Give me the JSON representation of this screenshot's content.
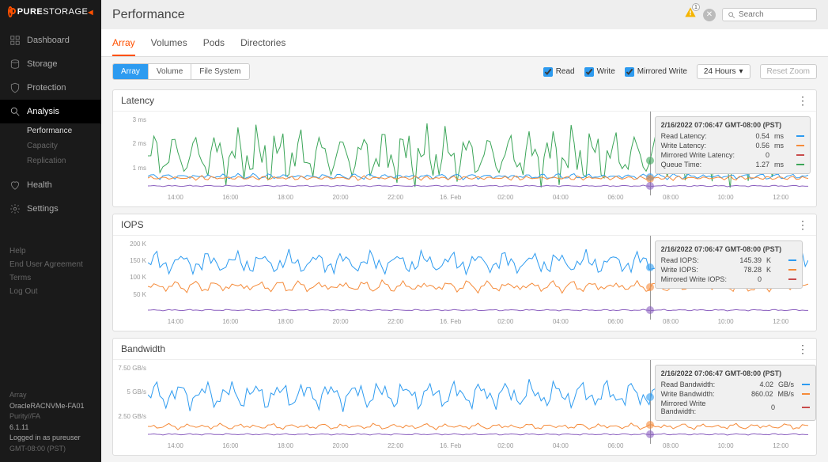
{
  "brand": {
    "pure": "PURE",
    "storage": "STORAGE"
  },
  "page_title": "Performance",
  "search": {
    "placeholder": "Search"
  },
  "alerts": {
    "count": "1"
  },
  "nav": {
    "items": [
      {
        "label": "Dashboard",
        "icon": "dashboard"
      },
      {
        "label": "Storage",
        "icon": "storage"
      },
      {
        "label": "Protection",
        "icon": "shield"
      },
      {
        "label": "Analysis",
        "icon": "magnify",
        "active": true,
        "sub": [
          {
            "label": "Performance",
            "sel": true
          },
          {
            "label": "Capacity"
          },
          {
            "label": "Replication"
          }
        ]
      },
      {
        "label": "Health",
        "icon": "heart"
      },
      {
        "label": "Settings",
        "icon": "gear"
      }
    ]
  },
  "footer_links": [
    "Help",
    "End User Agreement",
    "Terms",
    "Log Out"
  ],
  "status": {
    "l1": "Array",
    "l2": "OracleRACNVMe-FA01",
    "l3": "Purity//FA",
    "l4": "6.1.11",
    "l5": "Logged in as pureuser",
    "l6": "GMT-08:00 (PST)"
  },
  "tabs": [
    "Array",
    "Volumes",
    "Pods",
    "Directories"
  ],
  "tabs_active": 0,
  "scope_buttons": [
    "Array",
    "Volume",
    "File System"
  ],
  "scope_active": 0,
  "series_checks": [
    {
      "label": "Read",
      "checked": true
    },
    {
      "label": "Write",
      "checked": true
    },
    {
      "label": "Mirrored Write",
      "checked": true
    }
  ],
  "time_range": "24 Hours",
  "reset_zoom": "Reset Zoom",
  "x_ticks": [
    "14:00",
    "16:00",
    "18:00",
    "20:00",
    "22:00",
    "16. Feb",
    "02:00",
    "04:00",
    "06:00",
    "08:00",
    "10:00",
    "12:00"
  ],
  "cursor_pos_pct": 76,
  "cursor_ts": "2/16/2022 07:06:47 GMT-08:00 (PST)",
  "panels": {
    "latency": {
      "title": "Latency",
      "y": [
        "3 ms",
        "2 ms",
        "1 ms"
      ],
      "tooltip": [
        {
          "lbl": "Read Latency:",
          "val": "0.54",
          "unit": "ms",
          "color": "#2d9bf0"
        },
        {
          "lbl": "Write Latency:",
          "val": "0.56",
          "unit": "ms",
          "color": "#f58b3a"
        },
        {
          "lbl": "Mirrored Write Latency:",
          "val": "0",
          "unit": "",
          "color": "#c84b4b"
        },
        {
          "lbl": "Queue Time:",
          "val": "1.27",
          "unit": "ms",
          "color": "#3ba558"
        }
      ]
    },
    "iops": {
      "title": "IOPS",
      "y": [
        "200 K",
        "150 K",
        "100 K",
        "50 K"
      ],
      "tooltip": [
        {
          "lbl": "Read IOPS:",
          "val": "145.39",
          "unit": "K",
          "color": "#2d9bf0"
        },
        {
          "lbl": "Write IOPS:",
          "val": "78.28",
          "unit": "K",
          "color": "#f58b3a"
        },
        {
          "lbl": "Mirrored Write IOPS:",
          "val": "0",
          "unit": "",
          "color": "#c84b4b"
        }
      ]
    },
    "bandwidth": {
      "title": "Bandwidth",
      "y": [
        "7.50 GB/s",
        "5 GB/s",
        "2.50 GB/s"
      ],
      "tooltip": [
        {
          "lbl": "Read Bandwidth:",
          "val": "4.02",
          "unit": "GB/s",
          "color": "#2d9bf0"
        },
        {
          "lbl": "Write Bandwidth:",
          "val": "860.02",
          "unit": "MB/s",
          "color": "#f58b3a"
        },
        {
          "lbl": "Mirrored Write Bandwidth:",
          "val": "0",
          "unit": "",
          "color": "#c84b4b"
        }
      ]
    }
  },
  "chart_data": {
    "x_hours": [
      14,
      15,
      16,
      17,
      18,
      19,
      20,
      21,
      22,
      23,
      0,
      1,
      2,
      3,
      4,
      5,
      6,
      7,
      8,
      9,
      10,
      11,
      12,
      13
    ],
    "charts": [
      {
        "type": "line",
        "title": "Latency",
        "ylabel": "ms",
        "ylim": [
          0,
          3
        ],
        "series": [
          {
            "name": "Queue Time",
            "color": "#3ba558",
            "values": [
              1.6,
              2.1,
              1.4,
              1.9,
              2.3,
              1.3,
              1.7,
              2.4,
              1.5,
              2.0,
              1.2,
              2.2,
              1.6,
              1.9,
              2.5,
              1.4,
              2.1,
              1.3,
              1.8,
              2.2,
              1.5,
              2.0,
              1.7,
              2.3
            ]
          },
          {
            "name": "Read Latency",
            "color": "#2d9bf0",
            "values": [
              0.5,
              0.55,
              0.52,
              0.54,
              0.56,
              0.53,
              0.55,
              0.57,
              0.54,
              0.55,
              0.52,
              0.56,
              0.55,
              0.54,
              0.57,
              0.53,
              0.55,
              0.54,
              0.56,
              0.55,
              0.53,
              0.55,
              0.54,
              0.56
            ]
          },
          {
            "name": "Write Latency",
            "color": "#f58b3a",
            "values": [
              0.54,
              0.56,
              0.55,
              0.57,
              0.56,
              0.55,
              0.56,
              0.58,
              0.56,
              0.57,
              0.55,
              0.57,
              0.56,
              0.56,
              0.58,
              0.55,
              0.56,
              0.56,
              0.57,
              0.56,
              0.55,
              0.56,
              0.56,
              0.57
            ]
          },
          {
            "name": "Mirrored Write Latency",
            "color": "#8b5fbf",
            "values": [
              0,
              0,
              0,
              0,
              0,
              0,
              0,
              0,
              0,
              0,
              0,
              0,
              0,
              0,
              0,
              0,
              0,
              0,
              0,
              0,
              0,
              0,
              0,
              0
            ]
          }
        ]
      },
      {
        "type": "line",
        "title": "IOPS",
        "ylabel": "K",
        "ylim": [
          0,
          200
        ],
        "series": [
          {
            "name": "Read IOPS",
            "color": "#2d9bf0",
            "values": [
              150,
              135,
              140,
              130,
              138,
              142,
              128,
              136,
              130,
              140,
              132,
              138,
              130,
              135,
              140,
              128,
              142,
              145,
              130,
              138,
              132,
              140,
              135,
              130
            ]
          },
          {
            "name": "Write IOPS",
            "color": "#f58b3a",
            "values": [
              78,
              75,
              80,
              76,
              79,
              77,
              78,
              80,
              76,
              79,
              77,
              80,
              78,
              77,
              80,
              76,
              79,
              78,
              77,
              80,
              78,
              79,
              77,
              80
            ]
          },
          {
            "name": "Mirrored Write IOPS",
            "color": "#8b5fbf",
            "values": [
              0,
              0,
              0,
              0,
              0,
              0,
              0,
              0,
              0,
              0,
              0,
              0,
              0,
              0,
              0,
              0,
              0,
              0,
              0,
              0,
              0,
              0,
              0,
              0
            ]
          }
        ]
      },
      {
        "type": "line",
        "title": "Bandwidth",
        "ylabel": "GB/s",
        "ylim": [
          0,
          7.5
        ],
        "series": [
          {
            "name": "Read Bandwidth",
            "color": "#2d9bf0",
            "values": [
              4.8,
              4.2,
              4.5,
              3.9,
              4.3,
              4.6,
              4.0,
              4.4,
              4.1,
              4.5,
              4.2,
              4.6,
              4.0,
              4.3,
              4.7,
              3.9,
              4.5,
              4.0,
              4.2,
              4.6,
              4.1,
              4.4,
              4.3,
              4.0
            ]
          },
          {
            "name": "Write Bandwidth",
            "color": "#f58b3a",
            "values": [
              0.85,
              0.86,
              0.87,
              0.85,
              0.86,
              0.86,
              0.87,
              0.86,
              0.85,
              0.86,
              0.87,
              0.86,
              0.86,
              0.87,
              0.85,
              0.86,
              0.87,
              0.86,
              0.86,
              0.87,
              0.86,
              0.86,
              0.87,
              0.86
            ]
          },
          {
            "name": "Mirrored Write Bandwidth",
            "color": "#8b5fbf",
            "values": [
              0,
              0,
              0,
              0,
              0,
              0,
              0,
              0,
              0,
              0,
              0,
              0,
              0,
              0,
              0,
              0,
              0,
              0,
              0,
              0,
              0,
              0,
              0,
              0
            ]
          }
        ]
      }
    ]
  }
}
